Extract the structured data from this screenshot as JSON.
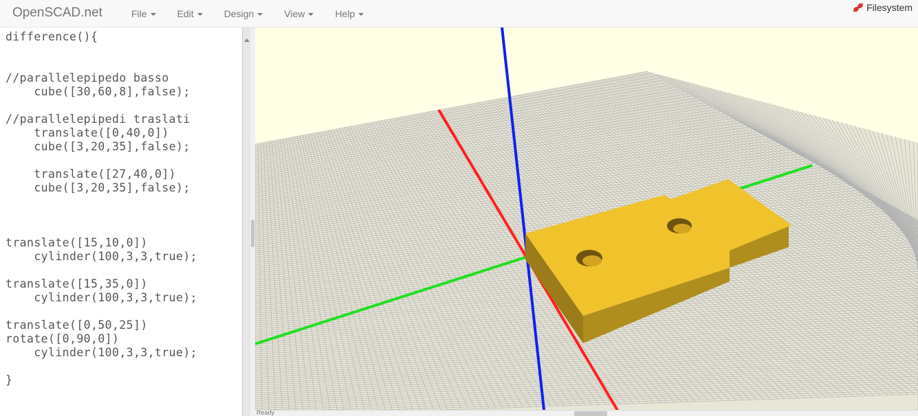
{
  "navbar": {
    "brand": "OpenSCAD.net",
    "menus": [
      {
        "label": "File"
      },
      {
        "label": "Edit"
      },
      {
        "label": "Design"
      },
      {
        "label": "View"
      },
      {
        "label": "Help"
      }
    ],
    "filesystem_label": "Filesystem",
    "filesystem_icon": "plug-icon"
  },
  "editor": {
    "lines": [
      "difference(){",
      "",
      "",
      "//parallelepipedo basso",
      "    cube([30,60,8],false);",
      "",
      "//parallelepipedi traslati",
      "    translate([0,40,0])",
      "    cube([3,20,35],false);",
      "",
      "    translate([27,40,0])",
      "    cube([3,20,35],false);",
      "",
      "",
      "",
      "translate([15,10,0])",
      "    cylinder(100,3,3,true);",
      "",
      "translate([15,35,0])",
      "    cylinder(100,3,3,true);",
      "",
      "translate([0,50,25])",
      "rotate([0,90,0])",
      "    cylinder(100,3,3,true);",
      "",
      "}"
    ]
  },
  "viewport": {
    "background": "#ffffe5",
    "grid_color": "#b4b4b4",
    "axis_x_color": "#ff2020",
    "axis_y_color": "#20e020",
    "axis_z_color": "#1020f0",
    "model_top_color": "#f0c22c",
    "model_side_color": "#9c7c1a",
    "model_front_color": "#b08e1e",
    "status_text": "Ready"
  }
}
